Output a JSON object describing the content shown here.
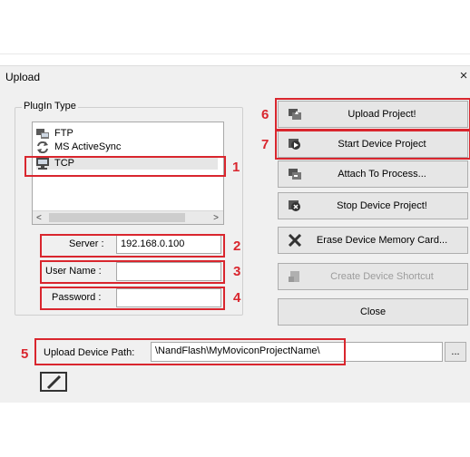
{
  "dialog": {
    "title": "Upload",
    "close": "×"
  },
  "plugin": {
    "group_label": "PlugIn Type",
    "items": [
      {
        "label": "FTP",
        "icon": "ftp-icon"
      },
      {
        "label": "MS ActiveSync",
        "icon": "activesync-icon"
      },
      {
        "label": "TCP",
        "icon": "tcp-icon",
        "selected": true
      }
    ],
    "scroll_left": "<",
    "scroll_right": ">"
  },
  "fields": {
    "server_label": "Server :",
    "server_value": "192.168.0.100",
    "username_label": "User Name :",
    "username_value": "",
    "password_label": "Password :",
    "password_value": ""
  },
  "buttons": {
    "upload_project": "Upload Project!",
    "start_device_project": "Start Device Project",
    "attach_to_process": "Attach To Process...",
    "stop_device_project": "Stop Device Project!",
    "erase_device_memory": "Erase Device Memory Card...",
    "create_device_shortcut": "Create Device Shortcut",
    "close": "Close"
  },
  "path": {
    "label": "Upload Device Path:",
    "value": "\\NandFlash\\MyMoviconProjectName\\",
    "browse": "..."
  },
  "annotations": [
    "1",
    "2",
    "3",
    "4",
    "5",
    "6",
    "7"
  ],
  "colors": {
    "annotation_red": "#d9262e",
    "dialog_bg": "#f0f0f0"
  }
}
